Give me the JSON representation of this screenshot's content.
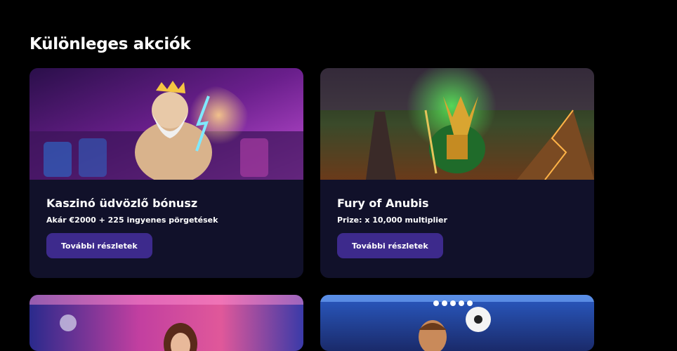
{
  "section": {
    "title": "Különleges akciók"
  },
  "promotions": [
    {
      "title": "Kaszinó üdvözlő bónusz",
      "subtitle": "Akár €2000 + 225 ingyenes pörgetések",
      "button_label": "További részletek",
      "image": "zeus-casino-banner"
    },
    {
      "title": "Fury of Anubis",
      "subtitle": "Prize: x 10,000 multiplier",
      "button_label": "További részletek",
      "image": "anubis-pyramid-banner"
    },
    {
      "image": "disco-woman-banner"
    },
    {
      "image": "football-player-banner"
    }
  ],
  "colors": {
    "page_background": "#000000",
    "card_background": "#11112a",
    "button_background": "#3d2a8c",
    "text": "#ffffff"
  }
}
